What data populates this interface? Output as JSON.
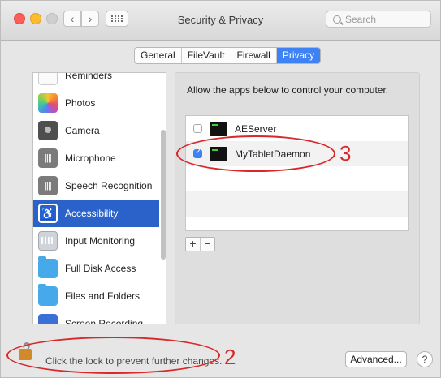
{
  "window": {
    "title": "Security & Privacy",
    "search_placeholder": "Search"
  },
  "tabs": [
    {
      "label": "General",
      "active": false
    },
    {
      "label": "FileVault",
      "active": false
    },
    {
      "label": "Firewall",
      "active": false
    },
    {
      "label": "Privacy",
      "active": true
    }
  ],
  "sidebar": {
    "items": [
      {
        "label": "Reminders",
        "icon": "reminders-icon"
      },
      {
        "label": "Photos",
        "icon": "photos-icon"
      },
      {
        "label": "Camera",
        "icon": "camera-icon"
      },
      {
        "label": "Microphone",
        "icon": "microphone-icon"
      },
      {
        "label": "Speech Recognition",
        "icon": "speech-recognition-icon"
      },
      {
        "label": "Accessibility",
        "icon": "accessibility-icon",
        "selected": true
      },
      {
        "label": "Input Monitoring",
        "icon": "keyboard-icon"
      },
      {
        "label": "Full Disk Access",
        "icon": "folder-icon"
      },
      {
        "label": "Files and Folders",
        "icon": "folder-icon"
      },
      {
        "label": "Screen Recording",
        "icon": "screen-recording-icon"
      }
    ]
  },
  "main": {
    "description": "Allow the apps below to control your computer.",
    "apps": [
      {
        "name": "AEServer",
        "checked": false,
        "icon": "terminal-icon"
      },
      {
        "name": "MyTabletDaemon",
        "checked": true,
        "icon": "terminal-icon"
      }
    ],
    "add_label": "+",
    "remove_label": "−"
  },
  "footer": {
    "lock_text": "Click the lock to prevent further changes.",
    "advanced_label": "Advanced...",
    "help_label": "?"
  },
  "annotations": {
    "label_3": "3",
    "label_2": "2"
  },
  "colors": {
    "accent": "#3f82f3",
    "selection": "#2a62c9",
    "annotation": "#d8282a"
  }
}
